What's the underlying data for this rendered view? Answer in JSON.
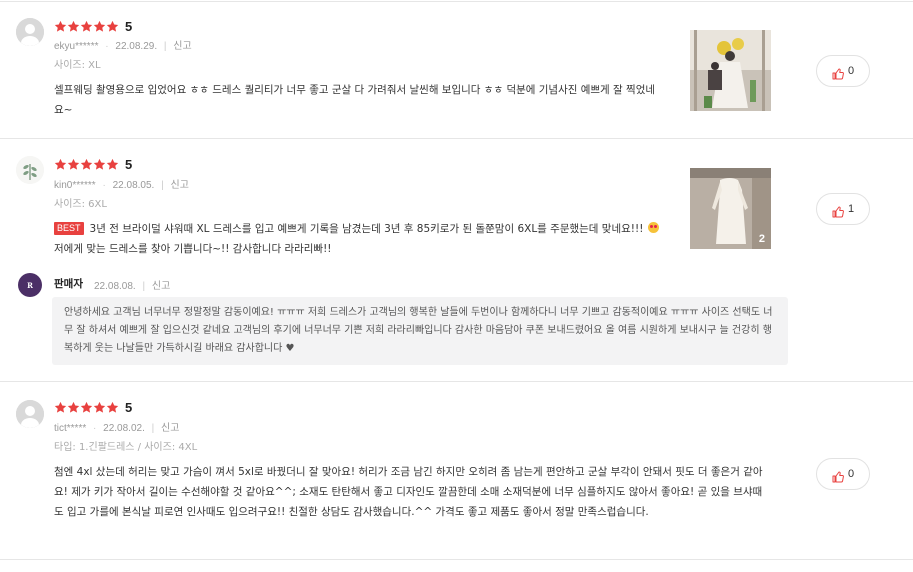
{
  "colors": {
    "star": "#e8413f",
    "badge": "#e8413f",
    "like_icon": "#e8413f",
    "seller_logo_bg": "#4b2f66"
  },
  "reviews": [
    {
      "score": "5",
      "user": "ekyu******",
      "date": "22.08.29.",
      "report": "신고",
      "option": "사이즈: XL",
      "text": "셀프웨딩 촬영용으로 입었어요 ㅎㅎ 드레스 퀄리티가 너무 좋고 군살 다 가려줘서 날씬해 보입니다 ㅎㅎ 덕분에 기념사진 예쁘게 잘 찍었네요~",
      "likes": "0",
      "avatar_icon": "default-user-icon"
    },
    {
      "score": "5",
      "user": "kin0******",
      "date": "22.08.05.",
      "report": "신고",
      "option": "사이즈: 6XL",
      "badge": "BEST",
      "text_part1": "3년 전 브라이덜 샤워때 XL 드레스를 입고 예쁘게 기록을 남겼는데 3년 후 85키로가 된 돌쭌맘이 6XL를 주문했는데 맞네요!!!",
      "text_part2": "저에게 맞는 드레스를 찾아 기쁩니다~!! 감사합니다 라라리빠!!",
      "image_count": "2",
      "likes": "1",
      "avatar_icon": "plant-avatar-icon",
      "seller_reply": {
        "name": "판매자",
        "date": "22.08.08.",
        "report": "신고",
        "logo_text": "R",
        "text": "안녕하세요 고객님 너무너무 정말정말 감동이예요! ㅠㅠㅠ 저희 드레스가 고객님의 행복한 날들에 두번이나 함께하다니 너무 기쁘고 감동적이예요 ㅠㅠㅠ 사이즈 선택도 너무 잘 하셔서 예쁘게 잘 입으신것 같네요 고객님의 후기에 너무너무 기쁜 저희 라라리빠입니다 감사한 마음담아 쿠폰 보내드렸어요 올 여름 시원하게 보내시구 늘 건강히 행복하게 웃는 나날들만 가득하시길 바래요 감사합니다 ♥"
      }
    },
    {
      "score": "5",
      "user": "tict*****",
      "date": "22.08.02.",
      "report": "신고",
      "option": "타입: 1.긴팔드레스 / 사이즈: 4XL",
      "text": "첨엔 4xl 샀는데 허리는 맞고 가슴이 껴서 5xl로 바꿨더니 잘 맞아요! 허리가 조금 남긴 하지만 오히려 좀 남는게 편안하고 군살 부각이 안돼서 핏도 더 좋은거 같아요! 제가 키가 작아서 길이는 수선해야할 것 같아요^^; 소재도 탄탄해서 좋고 디자인도 깔끔한데 소매 소재덕분에 너무 심플하지도 않아서 좋아요! 곧 있을 브샤때도 입고 가를에 본식날 피로연 인사때도 입으려구요!! 친절한 상담도 감사했습니다.^^ 가격도 좋고 제품도 좋아서 정말 만족스럽습니다.",
      "likes": "0",
      "avatar_icon": "default-user-icon"
    }
  ]
}
